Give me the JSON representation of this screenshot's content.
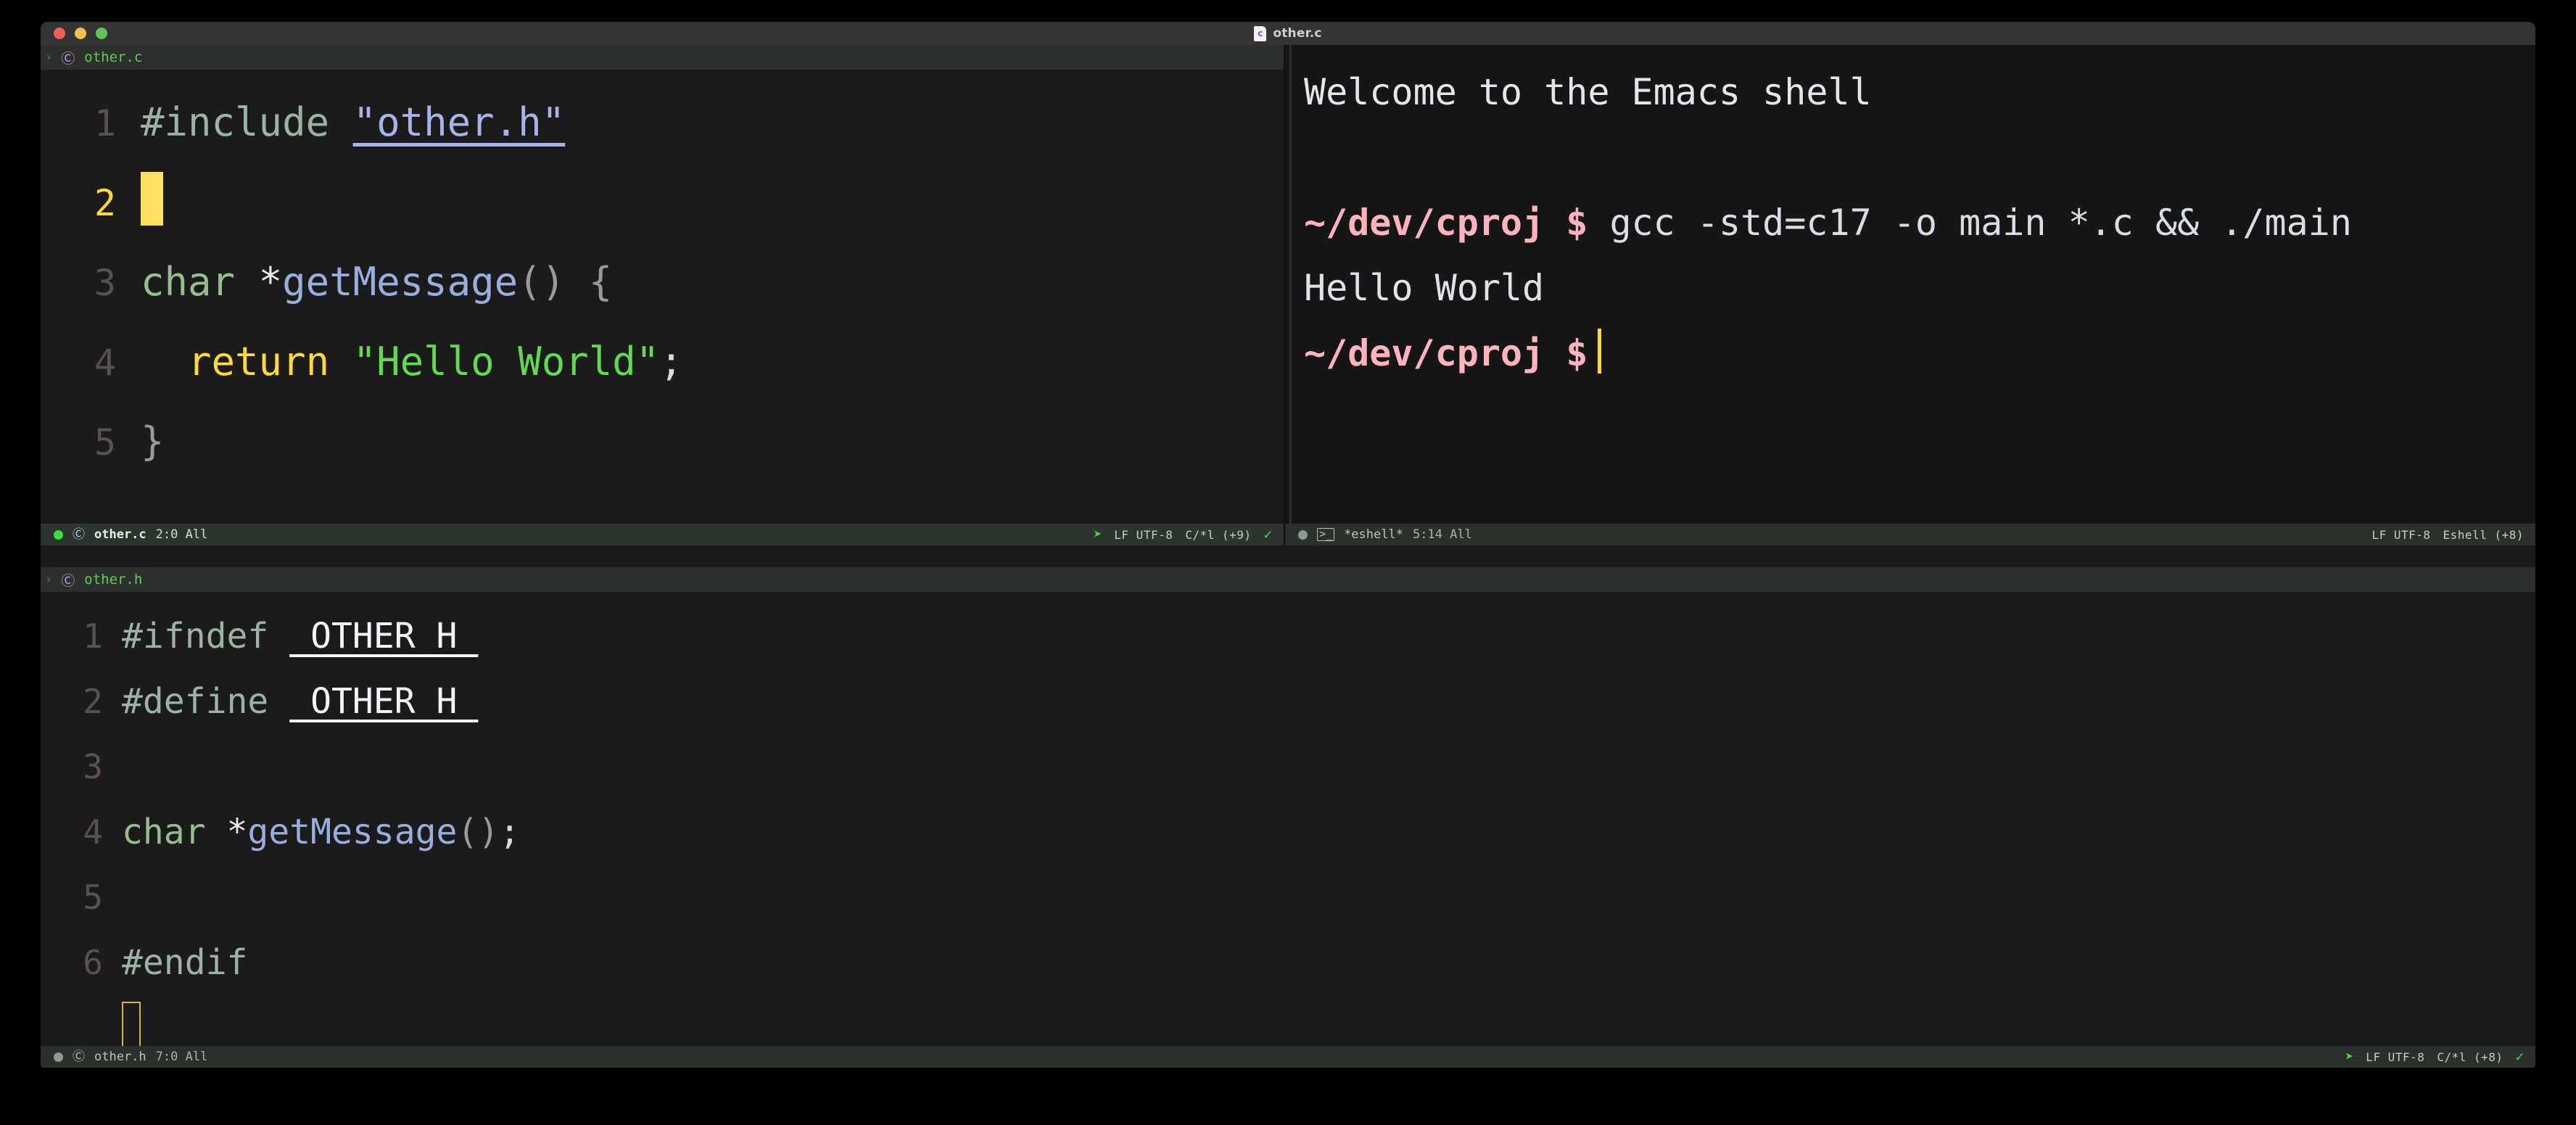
{
  "window": {
    "title": "other.c",
    "file_icon": "c-file-icon",
    "traffic_lights": [
      "close",
      "minimize",
      "zoom"
    ]
  },
  "editor_top": {
    "tab": {
      "chevron": "›",
      "icon": "c-lang-icon",
      "icon_glyph": "Ⓒ",
      "name": "other.c"
    },
    "lines": [
      {
        "num": "1",
        "active": false,
        "tokens": [
          {
            "text": "#include ",
            "cls": "s-pre"
          },
          {
            "text": "\"other.h\"",
            "cls": "s-str-h"
          }
        ]
      },
      {
        "num": "2",
        "active": true,
        "tokens": [],
        "cursor": "block"
      },
      {
        "num": "3",
        "active": false,
        "tokens": [
          {
            "text": "char ",
            "cls": "s-type"
          },
          {
            "text": "*",
            "cls": "s-op"
          },
          {
            "text": "getMessage",
            "cls": "s-fn"
          },
          {
            "text": "() {",
            "cls": "s-punct"
          }
        ]
      },
      {
        "num": "4",
        "active": false,
        "tokens": [
          {
            "text": "  return ",
            "cls": "s-kw"
          },
          {
            "text": "\"Hello World\"",
            "cls": "s-str"
          },
          {
            "text": ";",
            "cls": "s-semi"
          }
        ]
      },
      {
        "num": "5",
        "active": false,
        "tokens": [
          {
            "text": "}",
            "cls": "s-punct"
          }
        ]
      }
    ],
    "modeline": {
      "state_dot": "on",
      "icon": "c-lang-icon",
      "icon_glyph": "Ⓒ",
      "buffer": "other.c",
      "position": "2:0 All",
      "vc_icon": "rocket-icon",
      "vc_glyph": "➤",
      "encoding": "LF UTF-8",
      "major_mode": "C/*l (+9)",
      "status_icon": "check-icon",
      "status_glyph": "✓"
    }
  },
  "shell": {
    "welcome": "Welcome to the Emacs shell",
    "entries": [
      {
        "prompt": "~/dev/cproj $",
        "command": " gcc -std=c17 -o main *.c && ./main"
      },
      {
        "output": "Hello World"
      },
      {
        "prompt": "~/dev/cproj $",
        "command": "",
        "cursor": "bar"
      }
    ],
    "modeline": {
      "state_dot": "off",
      "icon": "terminal-icon",
      "icon_glyph": ">_",
      "buffer": "*eshell*",
      "position": "5:14 All",
      "encoding": "LF UTF-8",
      "major_mode": "Eshell (+8)"
    }
  },
  "editor_bottom": {
    "tab": {
      "chevron": "›",
      "icon": "c-lang-icon",
      "icon_glyph": "Ⓒ",
      "name": "other.h"
    },
    "lines": [
      {
        "num": "1",
        "active": false,
        "tokens": [
          {
            "text": "#ifndef ",
            "cls": "s-pre"
          },
          {
            "text": "_OTHER_H_",
            "cls": "u-white"
          }
        ]
      },
      {
        "num": "2",
        "active": false,
        "tokens": [
          {
            "text": "#define ",
            "cls": "s-pre"
          },
          {
            "text": "_OTHER_H_",
            "cls": "u-white"
          }
        ]
      },
      {
        "num": "3",
        "active": false,
        "tokens": []
      },
      {
        "num": "4",
        "active": false,
        "tokens": [
          {
            "text": "char ",
            "cls": "s-type"
          },
          {
            "text": "*",
            "cls": "s-op"
          },
          {
            "text": "getMessage",
            "cls": "s-fn"
          },
          {
            "text": "()",
            "cls": "s-punct"
          },
          {
            "text": ";",
            "cls": "s-semi"
          }
        ]
      },
      {
        "num": "5",
        "active": false,
        "tokens": []
      },
      {
        "num": "6",
        "active": false,
        "tokens": [
          {
            "text": "#endif",
            "cls": "s-pre"
          }
        ]
      },
      {
        "num": "",
        "active": false,
        "tokens": [],
        "cursor": "hollow"
      }
    ],
    "modeline": {
      "state_dot": "off",
      "icon": "c-lang-icon",
      "icon_glyph": "Ⓒ",
      "buffer": "other.h",
      "position": "7:0 All",
      "vc_icon": "rocket-icon",
      "vc_glyph": "➤",
      "encoding": "LF UTF-8",
      "major_mode": "C/*l (+8)",
      "status_icon": "check-icon",
      "status_glyph": "✓"
    }
  },
  "colors": {
    "background": "#000000",
    "window_bg": "#1b1b1b",
    "titlebar": "#343434",
    "tabline": "#2d2f2e",
    "modeline": "#2e3430",
    "accent_yellow": "#ffd83d",
    "string_green": "#62d950",
    "preproc_green": "#9bb3a3",
    "function_blue": "#9aaedd",
    "prompt_pink": "#ffb3bd"
  }
}
